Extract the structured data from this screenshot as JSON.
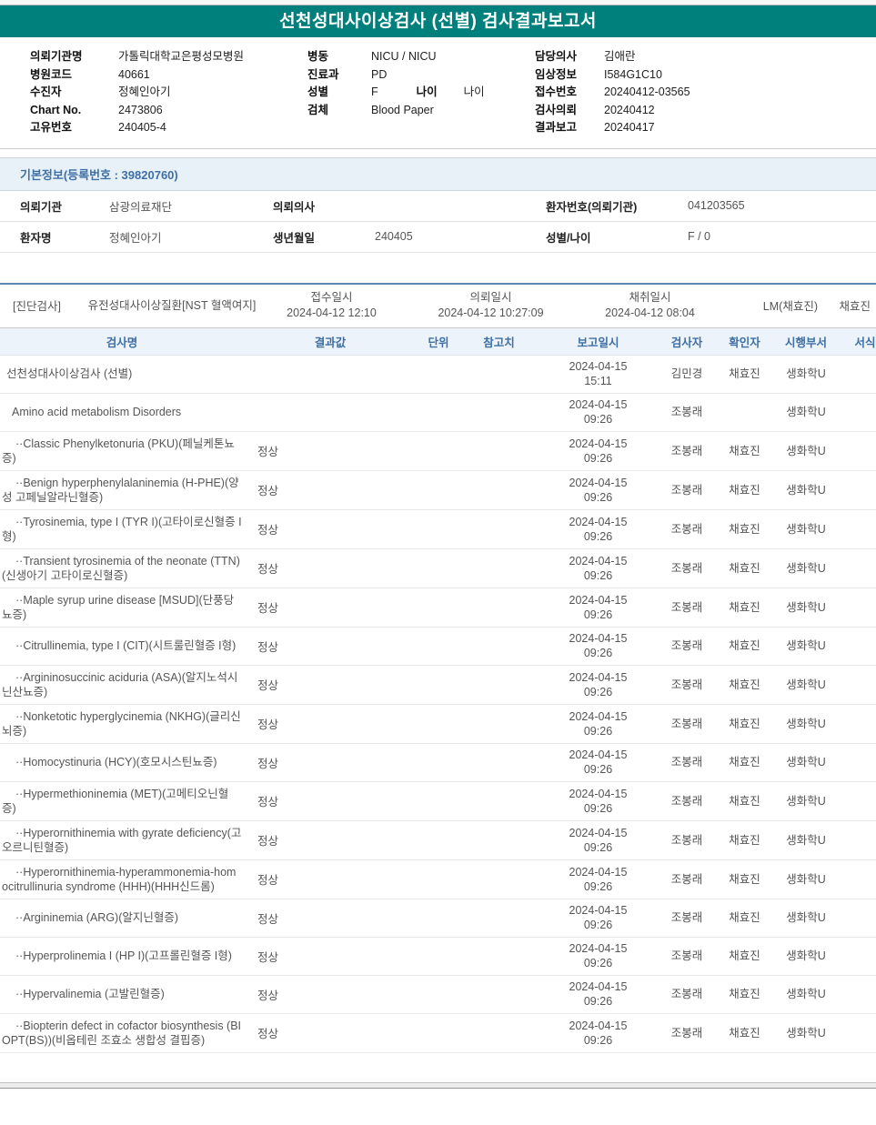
{
  "report": {
    "title": "선천성대사이상검사 (선별) 검사결과보고서"
  },
  "hospital_info": {
    "columns": [
      [
        {
          "label": "의뢰기관명",
          "value": "가톨릭대학교은평성모병원"
        },
        {
          "label": "병원코드",
          "value": "40661"
        },
        {
          "label": "수진자",
          "value": "정혜인아기"
        },
        {
          "label": "Chart No.",
          "value": "2473806"
        },
        {
          "label": "고유번호",
          "value": "240405-4"
        }
      ],
      [
        {
          "label": "병동",
          "value": "NICU / NICU"
        },
        {
          "label": "진료과",
          "value": "PD"
        },
        {
          "label": "성별",
          "value": "F",
          "label2": "나이",
          "value2": "나이"
        },
        {
          "label": "검체",
          "value": "Blood Paper"
        }
      ],
      [
        {
          "label": "담당의사",
          "value": "김애란"
        },
        {
          "label": "임상정보",
          "value": "I584G1C10"
        },
        {
          "label": "접수번호",
          "value": "20240412-03565"
        },
        {
          "label": "검사의뢰",
          "value": "20240412"
        },
        {
          "label": "결과보고",
          "value": "20240417"
        }
      ]
    ]
  },
  "basic_info": {
    "header": "기본정보(등록번호 : 39820760)",
    "rows": [
      [
        {
          "label": "의뢰기관",
          "value": "삼광의료재단"
        },
        {
          "label": "의뢰의사",
          "value": ""
        },
        {
          "label": "환자번호(의뢰기관)",
          "value": "041203565"
        }
      ],
      [
        {
          "label": "환자명",
          "value": "정혜인아기"
        },
        {
          "label": "생년월일",
          "value": "240405"
        },
        {
          "label": "성별/나이",
          "value": "F / 0"
        }
      ]
    ]
  },
  "diagnostic": {
    "tag": "[진단검사]",
    "test_group": "유전성대사이상질환[NST 혈액여지]",
    "receipt_label": "접수일시",
    "receipt_value": "2024-04-12 12:10",
    "request_label": "의뢰일시",
    "request_value": "2024-04-12 10:27:09",
    "collect_label": "채취일시",
    "collect_value": "2024-04-12 08:04",
    "lm": "LM(채효진)",
    "collector": "채효진"
  },
  "results_table": {
    "headers": [
      "검사명",
      "결과값",
      "단위",
      "참고치",
      "보고일시",
      "검사자",
      "확인자",
      "시행부서",
      "서식"
    ],
    "rows": [
      {
        "name": "선천성대사이상검사 (선별)",
        "result": "",
        "unit": "",
        "ref": "",
        "report": "2024-04-15 15:11",
        "tester": "김민경",
        "confirmer": "채효진",
        "dept": "생화학U",
        "form": "",
        "indent": 0
      },
      {
        "name": "Amino acid metabolism Disorders",
        "result": "",
        "unit": "",
        "ref": "",
        "report": "2024-04-15 09:26",
        "tester": "조봉래",
        "confirmer": "",
        "dept": "생화학U",
        "form": "",
        "indent": 1
      },
      {
        "name": "··Classic Phenylketonuria (PKU)(페닐케톤뇨증)",
        "result": "정상",
        "unit": "",
        "ref": "",
        "report": "2024-04-15 09:26",
        "tester": "조봉래",
        "confirmer": "채효진",
        "dept": "생화학U",
        "form": "",
        "indent": 2
      },
      {
        "name": "··Benign hyperphenylalaninemia (H-PHE)(양성 고페닐알라닌혈증)",
        "result": "정상",
        "unit": "",
        "ref": "",
        "report": "2024-04-15 09:26",
        "tester": "조봉래",
        "confirmer": "채효진",
        "dept": "생화학U",
        "form": "",
        "indent": 2
      },
      {
        "name": "··Tyrosinemia, type I (TYR I)(고타이로신혈증 I형)",
        "result": "정상",
        "unit": "",
        "ref": "",
        "report": "2024-04-15 09:26",
        "tester": "조봉래",
        "confirmer": "채효진",
        "dept": "생화학U",
        "form": "",
        "indent": 2
      },
      {
        "name": "··Transient tyrosinemia of the neonate (TTN)(신생아기 고타이로신혈증)",
        "result": "정상",
        "unit": "",
        "ref": "",
        "report": "2024-04-15 09:26",
        "tester": "조봉래",
        "confirmer": "채효진",
        "dept": "생화학U",
        "form": "",
        "indent": 2
      },
      {
        "name": "··Maple syrup urine disease [MSUD](단풍당뇨증)",
        "result": "정상",
        "unit": "",
        "ref": "",
        "report": "2024-04-15 09:26",
        "tester": "조봉래",
        "confirmer": "채효진",
        "dept": "생화학U",
        "form": "",
        "indent": 2
      },
      {
        "name": "··Citrullinemia, type I (CIT)(시트룰린혈증 I형)",
        "result": "정상",
        "unit": "",
        "ref": "",
        "report": "2024-04-15 09:26",
        "tester": "조봉래",
        "confirmer": "채효진",
        "dept": "생화학U",
        "form": "",
        "indent": 2
      },
      {
        "name": "··Argininosuccinic aciduria (ASA)(알지노석시닌산뇨증)",
        "result": "정상",
        "unit": "",
        "ref": "",
        "report": "2024-04-15 09:26",
        "tester": "조봉래",
        "confirmer": "채효진",
        "dept": "생화학U",
        "form": "",
        "indent": 2
      },
      {
        "name": "··Nonketotic hyperglycinemia (NKHG)(글리신뇌증)",
        "result": "정상",
        "unit": "",
        "ref": "",
        "report": "2024-04-15 09:26",
        "tester": "조봉래",
        "confirmer": "채효진",
        "dept": "생화학U",
        "form": "",
        "indent": 2
      },
      {
        "name": "··Homocystinuria (HCY)(호모시스틴뇨증)",
        "result": "정상",
        "unit": "",
        "ref": "",
        "report": "2024-04-15 09:26",
        "tester": "조봉래",
        "confirmer": "채효진",
        "dept": "생화학U",
        "form": "",
        "indent": 2
      },
      {
        "name": "··Hypermethioninemia (MET)(고메티오닌혈증)",
        "result": "정상",
        "unit": "",
        "ref": "",
        "report": "2024-04-15 09:26",
        "tester": "조봉래",
        "confirmer": "채효진",
        "dept": "생화학U",
        "form": "",
        "indent": 2
      },
      {
        "name": "··Hyperornithinemia with gyrate deficiency(고오르니틴혈증)",
        "result": "정상",
        "unit": "",
        "ref": "",
        "report": "2024-04-15 09:26",
        "tester": "조봉래",
        "confirmer": "채효진",
        "dept": "생화학U",
        "form": "",
        "indent": 2
      },
      {
        "name": "··Hyperornithinemia-hyperammonemia-homocitrullinuria syndrome (HHH)(HHH신드롬)",
        "result": "정상",
        "unit": "",
        "ref": "",
        "report": "2024-04-15 09:26",
        "tester": "조봉래",
        "confirmer": "채효진",
        "dept": "생화학U",
        "form": "",
        "indent": 2
      },
      {
        "name": "··Argininemia (ARG)(알지닌혈증)",
        "result": "정상",
        "unit": "",
        "ref": "",
        "report": "2024-04-15 09:26",
        "tester": "조봉래",
        "confirmer": "채효진",
        "dept": "생화학U",
        "form": "",
        "indent": 2
      },
      {
        "name": "··Hyperprolinemia I (HP I)(고프롤린혈증 I형)",
        "result": "정상",
        "unit": "",
        "ref": "",
        "report": "2024-04-15 09:26",
        "tester": "조봉래",
        "confirmer": "채효진",
        "dept": "생화학U",
        "form": "",
        "indent": 2
      },
      {
        "name": "··Hypervalinemia (고발린혈증)",
        "result": "정상",
        "unit": "",
        "ref": "",
        "report": "2024-04-15 09:26",
        "tester": "조봉래",
        "confirmer": "채효진",
        "dept": "생화학U",
        "form": "",
        "indent": 2
      },
      {
        "name": "··Biopterin defect in cofactor biosynthesis (BIOPT(BS))(비옵테린 조효소 생합성 결핍증)",
        "result": "정상",
        "unit": "",
        "ref": "",
        "report": "2024-04-15 09:26",
        "tester": "조봉래",
        "confirmer": "채효진",
        "dept": "생화학U",
        "form": "",
        "indent": 2
      }
    ]
  }
}
